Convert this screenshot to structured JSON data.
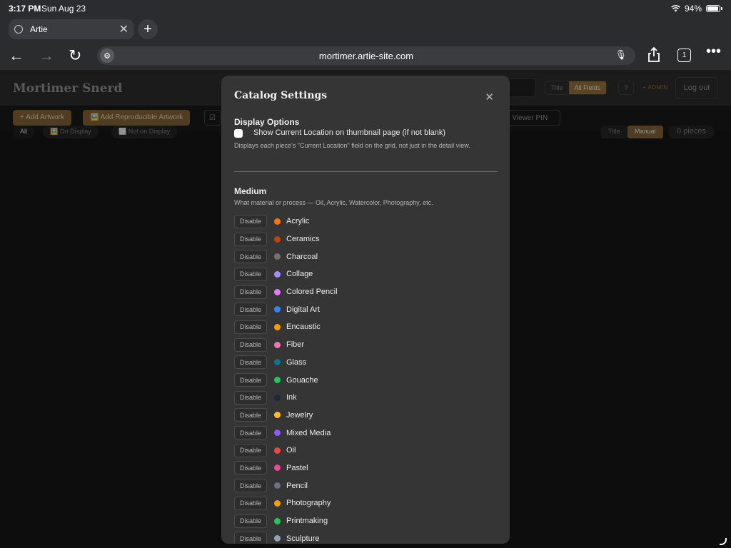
{
  "status": {
    "time": "3:17 PM",
    "date": "Sun Aug 23",
    "battery": "94%"
  },
  "browser": {
    "tab_title": "Artie",
    "url": "mortimer.artie-site.com",
    "tab_count": "1"
  },
  "app": {
    "brand": "Mortimer Snerd",
    "search_modes": [
      "Title",
      "All Fields"
    ],
    "help_label": "?",
    "admin_label": "+ ADMIN",
    "logout_label": "Log out",
    "actions": {
      "add_artwork": "+ Add Artwork",
      "add_reproducible": "🖼️ Add Reproducible Artwork",
      "checkbox_btn": "☑",
      "viewer_pin": "e Viewer PIN"
    },
    "filters": {
      "all": "All",
      "on_display": "🖼️ On Display",
      "not_on_display": "⬜ Not on Display"
    },
    "sort": [
      "Title",
      "Manual"
    ],
    "pieces": "0 pieces"
  },
  "modal": {
    "title": "Catalog Settings",
    "display_options": {
      "heading": "Display Options",
      "checkbox_label": "Show Current Location on thumbnail page (if not blank)",
      "checked": false,
      "help": "Displays each piece's \"Current Location\" field on the grid, not just in the detail view."
    },
    "medium": {
      "heading": "Medium",
      "help": "What material or process — Oil, Acrylic, Watercolor, Photography, etc.",
      "disable_label": "Disable",
      "items": [
        {
          "label": "Acrylic",
          "color": "#f97316"
        },
        {
          "label": "Ceramics",
          "color": "#c2410c"
        },
        {
          "label": "Charcoal",
          "color": "#78716c"
        },
        {
          "label": "Collage",
          "color": "#a78bfa"
        },
        {
          "label": "Colored Pencil",
          "color": "#e879f9"
        },
        {
          "label": "Digital Art",
          "color": "#3b82f6"
        },
        {
          "label": "Encaustic",
          "color": "#f59e0b"
        },
        {
          "label": "Fiber",
          "color": "#f472b6"
        },
        {
          "label": "Glass",
          "color": "#0e7490"
        },
        {
          "label": "Gouache",
          "color": "#22c55e"
        },
        {
          "label": "Ink",
          "color": "#1e293b"
        },
        {
          "label": "Jewelry",
          "color": "#fbbf24"
        },
        {
          "label": "Mixed Media",
          "color": "#8b5cf6"
        },
        {
          "label": "Oil",
          "color": "#ef4444"
        },
        {
          "label": "Pastel",
          "color": "#ec4899"
        },
        {
          "label": "Pencil",
          "color": "#6b7280"
        },
        {
          "label": "Photography",
          "color": "#f59e0b"
        },
        {
          "label": "Printmaking",
          "color": "#22c55e"
        },
        {
          "label": "Sculpture",
          "color": "#94a3b8"
        }
      ]
    }
  }
}
